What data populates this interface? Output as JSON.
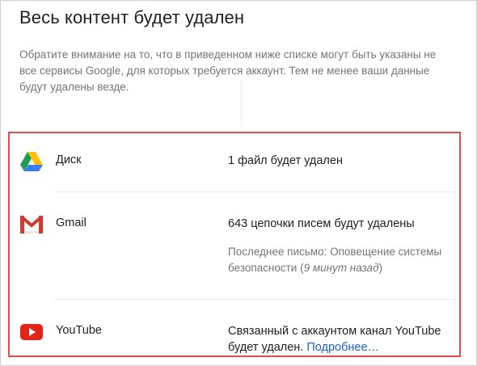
{
  "dialog": {
    "title": "Весь контент будет удален",
    "description": "Обратите внимание на то, что в приведенном ниже списке могут быть указаны не все сервисы Google, для которых требуется аккаунт. Тем не менее ваши данные будут удалены везде."
  },
  "services": [
    {
      "name": "Диск",
      "icon": "google-drive-icon",
      "status": "1 файл будет удален"
    },
    {
      "name": "Gmail",
      "icon": "gmail-icon",
      "status": "643 цепочки писем будут удалены",
      "detail_prefix": "Последнее письмо: Оповещение системы безопасности (",
      "detail_time": "9 минут назад",
      "detail_suffix": ")"
    },
    {
      "name": "YouTube",
      "icon": "youtube-icon",
      "status": "Связанный с аккаунтом канал YouTube будет удален.",
      "link": "Подробнее…"
    }
  ],
  "colors": {
    "highlight_border": "#e04b4b",
    "link": "#1a62c9",
    "muted_text": "#757575"
  }
}
